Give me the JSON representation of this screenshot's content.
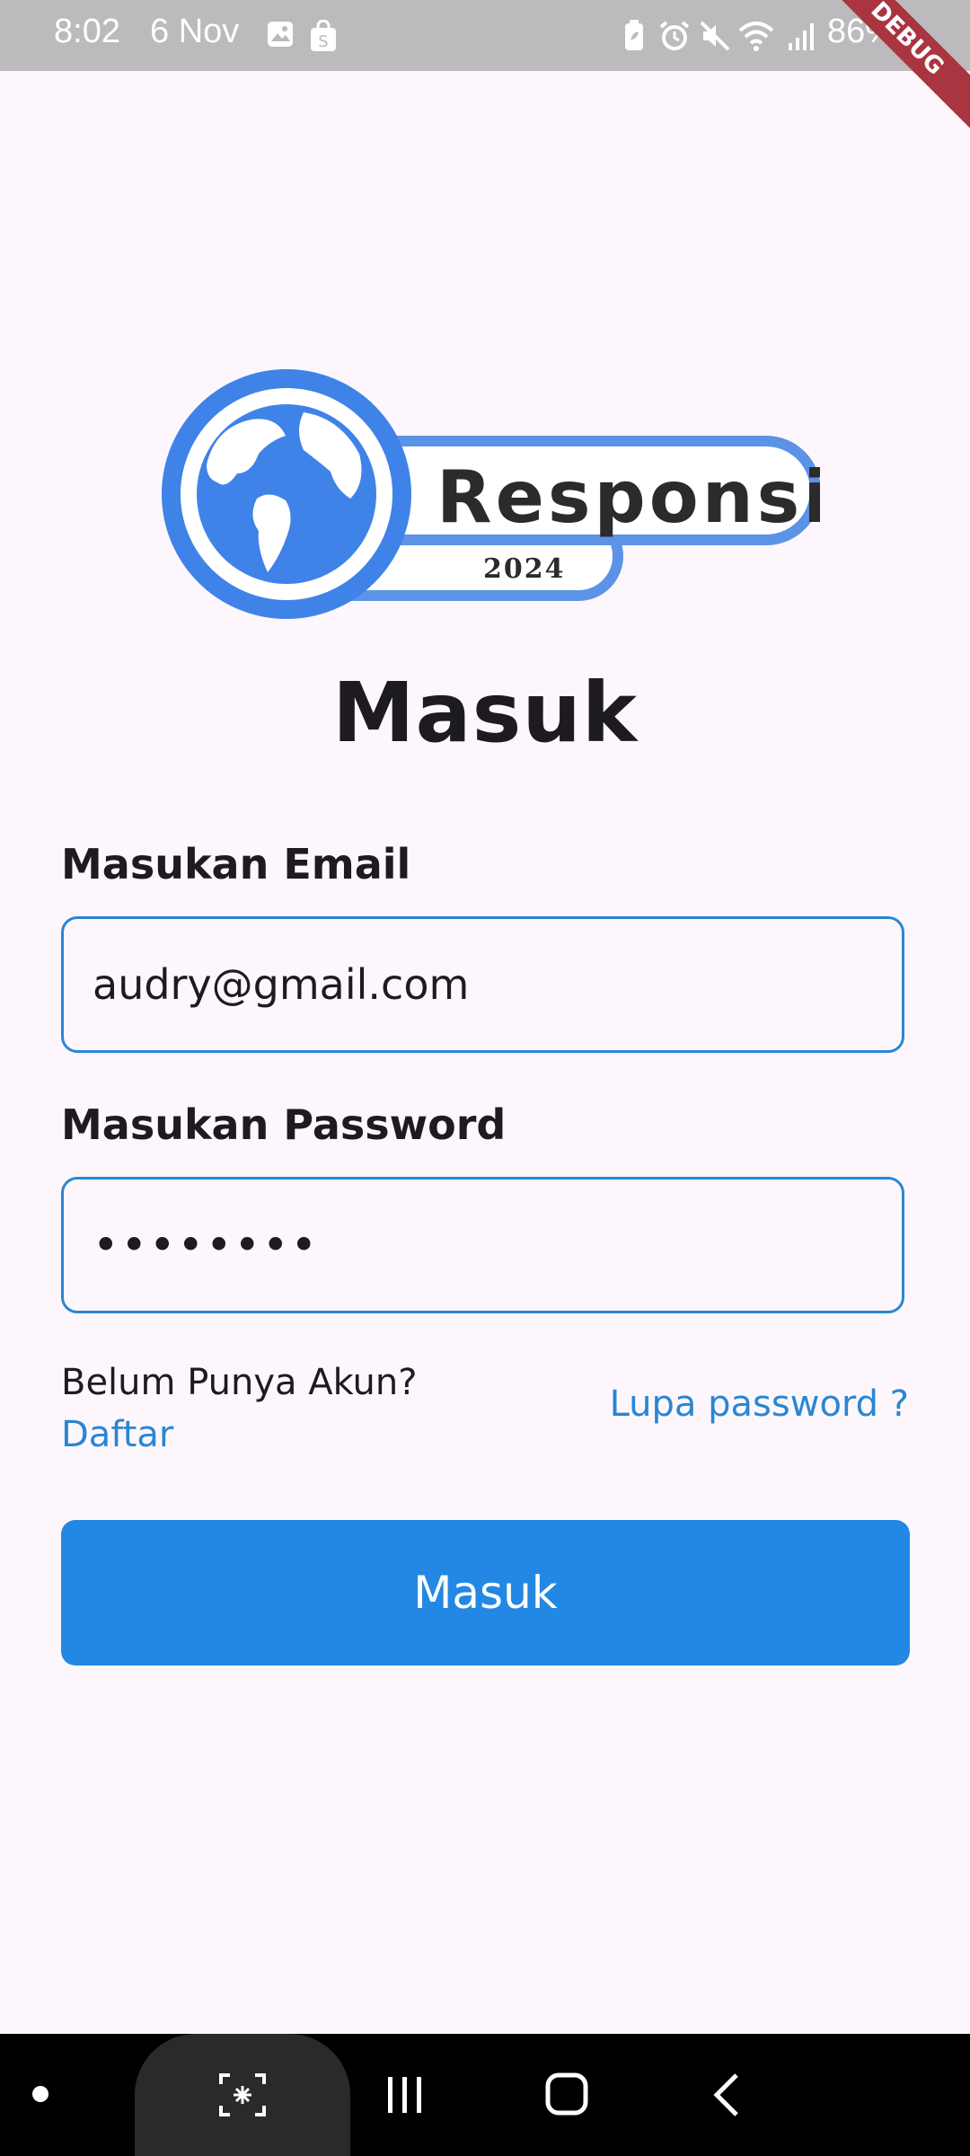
{
  "status_bar": {
    "time": "8:02",
    "date": "6 Nov",
    "battery": "86%",
    "left_icons": [
      "gallery-icon",
      "shop-icon"
    ],
    "right_icons": [
      "battery-saver-icon",
      "alarm-icon",
      "mute-icon",
      "wifi-icon",
      "signal-icon"
    ],
    "debug_label": "DEBUG"
  },
  "logo": {
    "title": "Responsi",
    "year": "2024",
    "accent": "#3F83E8"
  },
  "page": {
    "title": "Masuk"
  },
  "form": {
    "email_label": "Masukan Email",
    "email_value": "audry@gmail.com",
    "password_label": "Masukan Password",
    "password_value": "••••••••",
    "no_account_text": "Belum Punya Akun?",
    "register_link": "Daftar",
    "forgot_link": "Lupa password ?",
    "submit_label": "Masuk"
  },
  "nav_bar": {
    "buttons": [
      "home-dot-icon",
      "screenshot-icon",
      "recents-icon",
      "home-icon",
      "back-icon"
    ]
  },
  "colors": {
    "primary": "#2388E3",
    "link": "#2A86D2",
    "background": "#FDF7FD"
  }
}
